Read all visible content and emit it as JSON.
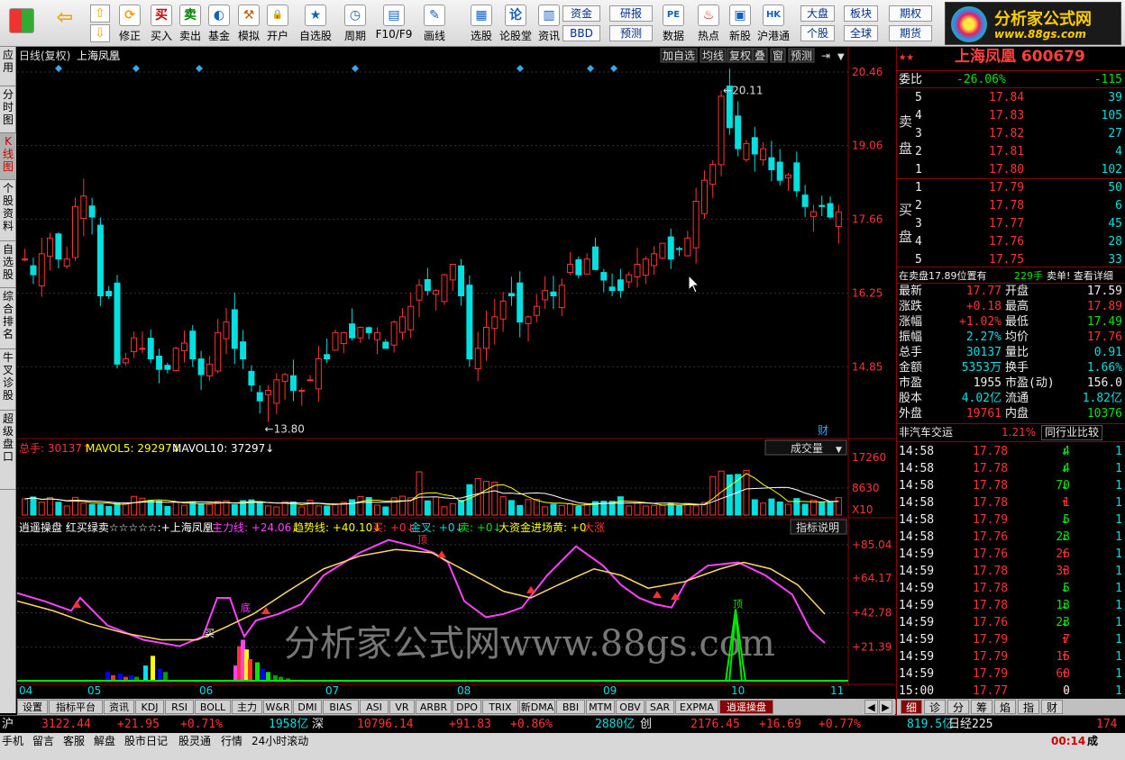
{
  "toolbar": {
    "buttons": [
      {
        "id": "buy",
        "label": "买入",
        "glyph": "买",
        "color": "#d00000"
      },
      {
        "id": "sell",
        "label": "卖出",
        "glyph": "卖",
        "color": "#008000"
      },
      {
        "id": "fund",
        "label": "基金",
        "glyph": "◐",
        "color": "#1060c0"
      },
      {
        "id": "sim",
        "label": "模拟",
        "glyph": "⚒",
        "color": "#c06000"
      },
      {
        "id": "open",
        "label": "开户",
        "glyph": "🔒",
        "color": "#806000"
      },
      {
        "id": "self",
        "label": "自选股",
        "glyph": "★",
        "color": "#1060c0"
      },
      {
        "id": "period",
        "label": "周期",
        "glyph": "◷",
        "color": "#1060c0"
      },
      {
        "id": "f10",
        "label": "F10/F9",
        "glyph": "▤",
        "color": "#1060c0"
      },
      {
        "id": "draw",
        "label": "画线",
        "glyph": "✎",
        "color": "#1060c0"
      },
      {
        "id": "select",
        "label": "选股",
        "glyph": "▦",
        "color": "#1060c0"
      },
      {
        "id": "forum",
        "label": "论股堂",
        "glyph": "论",
        "color": "#1060c0"
      },
      {
        "id": "news",
        "label": "资讯",
        "glyph": "▥",
        "color": "#1060c0"
      },
      {
        "id": "data",
        "label": "数据",
        "glyph": "PE",
        "color": "#1060c0"
      },
      {
        "id": "hot",
        "label": "热点",
        "glyph": "♨",
        "color": "#d00000"
      },
      {
        "id": "newstock",
        "label": "新股",
        "glyph": "▣",
        "color": "#1060c0"
      },
      {
        "id": "hk",
        "label": "沪港通",
        "glyph": "HK",
        "color": "#1060c0"
      }
    ],
    "fix_label": "修正",
    "small": {
      "capital": "资金",
      "bbd": "BBD",
      "research": "研报",
      "forecast": "预测",
      "market": "大盘",
      "sector": "板块",
      "futures": "期权",
      "stock": "个股",
      "global": "全球",
      "future2": "期货"
    }
  },
  "logo": {
    "name": "分析家公式网",
    "url": "www.88gs.com"
  },
  "left_tabs": [
    "应用",
    "分时图",
    "K线图",
    "个股资料",
    "自选股",
    "综合排名",
    "牛叉诊股",
    "超级盘口"
  ],
  "chart_header": {
    "label": "日线(复权)",
    "stock": "上海凤凰",
    "buttons": [
      "加自选",
      "均线",
      "复权",
      "叠",
      "窗",
      "预测"
    ]
  },
  "price_axis": [
    "20.46",
    "19.06",
    "17.66",
    "16.25",
    "14.85"
  ],
  "price_marks": {
    "high": "20.11",
    "low": "13.80"
  },
  "fin_tag": "财",
  "volume_header": {
    "total": "总手: 30137↑",
    "ma5": "MAVOL5: 29297↓",
    "ma10": "MAVOL10: 37297↓",
    "selector": "成交量"
  },
  "volume_axis": [
    "17260",
    "8630",
    "X10"
  ],
  "indicator_header": {
    "title": "逍遥操盘 红买绿卖☆☆☆☆☆:+上海凤凰",
    "main": "主力线: +24.06↓",
    "trend": "趋势线: +40.10↓",
    "buy": "买: +0↓",
    "cross": "金叉: +0↓",
    "sell": "卖: +0↓",
    "bigflow": "大资金进场黄: +0",
    "bigsuffix": "大涨",
    "help": "指标说明"
  },
  "indicator_axis": [
    "+85.04",
    "+64.17",
    "+42.78",
    "+21.39"
  ],
  "indicator_marks": {
    "buy": "买",
    "bottom": "底",
    "top": "顶"
  },
  "date_axis": [
    "04",
    "05",
    "06",
    "07",
    "08",
    "09",
    "10",
    "11"
  ],
  "watermark": "分析家公式网www.88gs.com",
  "bottom_tabs": [
    "设置",
    "指标平台",
    "资讯",
    "KDJ",
    "RSI",
    "BOLL",
    "主力",
    "W&R",
    "DMI",
    "BIAS",
    "ASI",
    "VR",
    "ARBR",
    "DPO",
    "TRIX",
    "新DMA",
    "BBI",
    "MTM",
    "OBV",
    "SAR",
    "EXPMA",
    "逍遥操盘"
  ],
  "sidebar": {
    "title": "上海凤凰 600679",
    "weibi": {
      "label": "委比",
      "pct": "-26.06%",
      "diff": "-115"
    },
    "sell_label": "卖盘",
    "buy_label": "买盘",
    "sell": [
      [
        "5",
        "17.84",
        "39"
      ],
      [
        "4",
        "17.83",
        "105"
      ],
      [
        "3",
        "17.82",
        "27"
      ],
      [
        "2",
        "17.81",
        "4"
      ],
      [
        "1",
        "17.80",
        "102"
      ]
    ],
    "buy": [
      [
        "1",
        "17.79",
        "50"
      ],
      [
        "2",
        "17.78",
        "6"
      ],
      [
        "3",
        "17.77",
        "45"
      ],
      [
        "4",
        "17.76",
        "28"
      ],
      [
        "5",
        "17.75",
        "33"
      ]
    ],
    "notice": {
      "left": "在卖盘17.89位置有",
      "qty": "229手",
      "right": "卖单! 查看详细"
    },
    "quotes": [
      {
        "l": "最新",
        "lv": "17.77",
        "lc": "red",
        "r": "开盘",
        "rv": "17.59",
        "rc": "white"
      },
      {
        "l": "涨跌",
        "lv": "+0.18",
        "lc": "red",
        "r": "最高",
        "rv": "17.89",
        "rc": "red"
      },
      {
        "l": "涨幅",
        "lv": "+1.02%",
        "lc": "red",
        "r": "最低",
        "rv": "17.49",
        "rc": "green"
      },
      {
        "l": "振幅",
        "lv": "2.27%",
        "lc": "cyan",
        "r": "均价",
        "rv": "17.76",
        "rc": "red"
      },
      {
        "l": "总手",
        "lv": "30137",
        "lc": "cyan",
        "r": "量比",
        "rv": "0.91",
        "rc": "cyan"
      },
      {
        "l": "金额",
        "lv": "5353万",
        "lc": "cyan",
        "r": "换手",
        "rv": "1.66%",
        "rc": "cyan"
      },
      {
        "l": "市盈",
        "lv": "1955",
        "lc": "white",
        "r": "市盈(动)",
        "rv": "156.0",
        "rc": "white"
      },
      {
        "l": "股本",
        "lv": "4.02亿",
        "lc": "cyan",
        "r": "流通",
        "rv": "1.82亿",
        "rc": "cyan"
      },
      {
        "l": "外盘",
        "lv": "19761",
        "lc": "red",
        "r": "内盘",
        "rv": "10376",
        "rc": "green"
      }
    ],
    "sector": {
      "name": "非汽车交运",
      "pct": "1.21%",
      "compare": "同行业比较"
    },
    "ticks": [
      [
        "14:58",
        "17.78",
        "4",
        "down"
      ],
      [
        "14:58",
        "17.78",
        "4",
        "down"
      ],
      [
        "14:58",
        "17.78",
        "70",
        "down"
      ],
      [
        "14:58",
        "17.78",
        "1",
        "up"
      ],
      [
        "14:58",
        "17.79",
        "5",
        "down"
      ],
      [
        "14:58",
        "17.76",
        "23",
        "down"
      ],
      [
        "14:59",
        "17.76",
        "26",
        "up"
      ],
      [
        "14:59",
        "17.78",
        "33",
        "up"
      ],
      [
        "14:59",
        "17.78",
        "5",
        "down"
      ],
      [
        "14:59",
        "17.78",
        "13",
        "down"
      ],
      [
        "14:59",
        "17.76",
        "23",
        "down"
      ],
      [
        "14:59",
        "17.79",
        "7",
        "up"
      ],
      [
        "14:59",
        "17.79",
        "15",
        "up"
      ],
      [
        "14:59",
        "17.79",
        "60",
        "up"
      ],
      [
        "15:00",
        "17.77",
        "0",
        "none"
      ]
    ],
    "tick_tail": "1",
    "tabs": [
      "细",
      "诊",
      "分",
      "筹",
      "焰",
      "指",
      "财"
    ]
  },
  "status": {
    "sh": {
      "name": "沪",
      "val": "3122.44",
      "chg": "+21.95",
      "pct": "+0.71%",
      "amt": "1958亿"
    },
    "sz": {
      "name": "深",
      "val": "10796.14",
      "chg": "+91.83",
      "pct": "+0.86%",
      "amt": "2880亿"
    },
    "cy": {
      "name": "创",
      "val": "2176.45",
      "chg": "+16.69",
      "pct": "+0.77%",
      "amt": "819.5亿"
    },
    "rj": {
      "name": "日经225",
      "val": "174"
    }
  },
  "status2": {
    "items": [
      "手机",
      "留言",
      "客服",
      "解盘",
      "股市日记",
      "股灵通",
      "行情",
      "24小时滚动"
    ],
    "time": "00:14",
    "label": "成"
  },
  "chart_data": {
    "type": "candlestick",
    "x": [
      "04",
      "05",
      "06",
      "07",
      "08",
      "09",
      "10",
      "11"
    ],
    "price_axis_range": [
      13.5,
      20.7
    ],
    "high": 20.11,
    "low": 13.8,
    "volume_axis": [
      0,
      17260
    ],
    "indicator_range": [
      0,
      95
    ]
  }
}
